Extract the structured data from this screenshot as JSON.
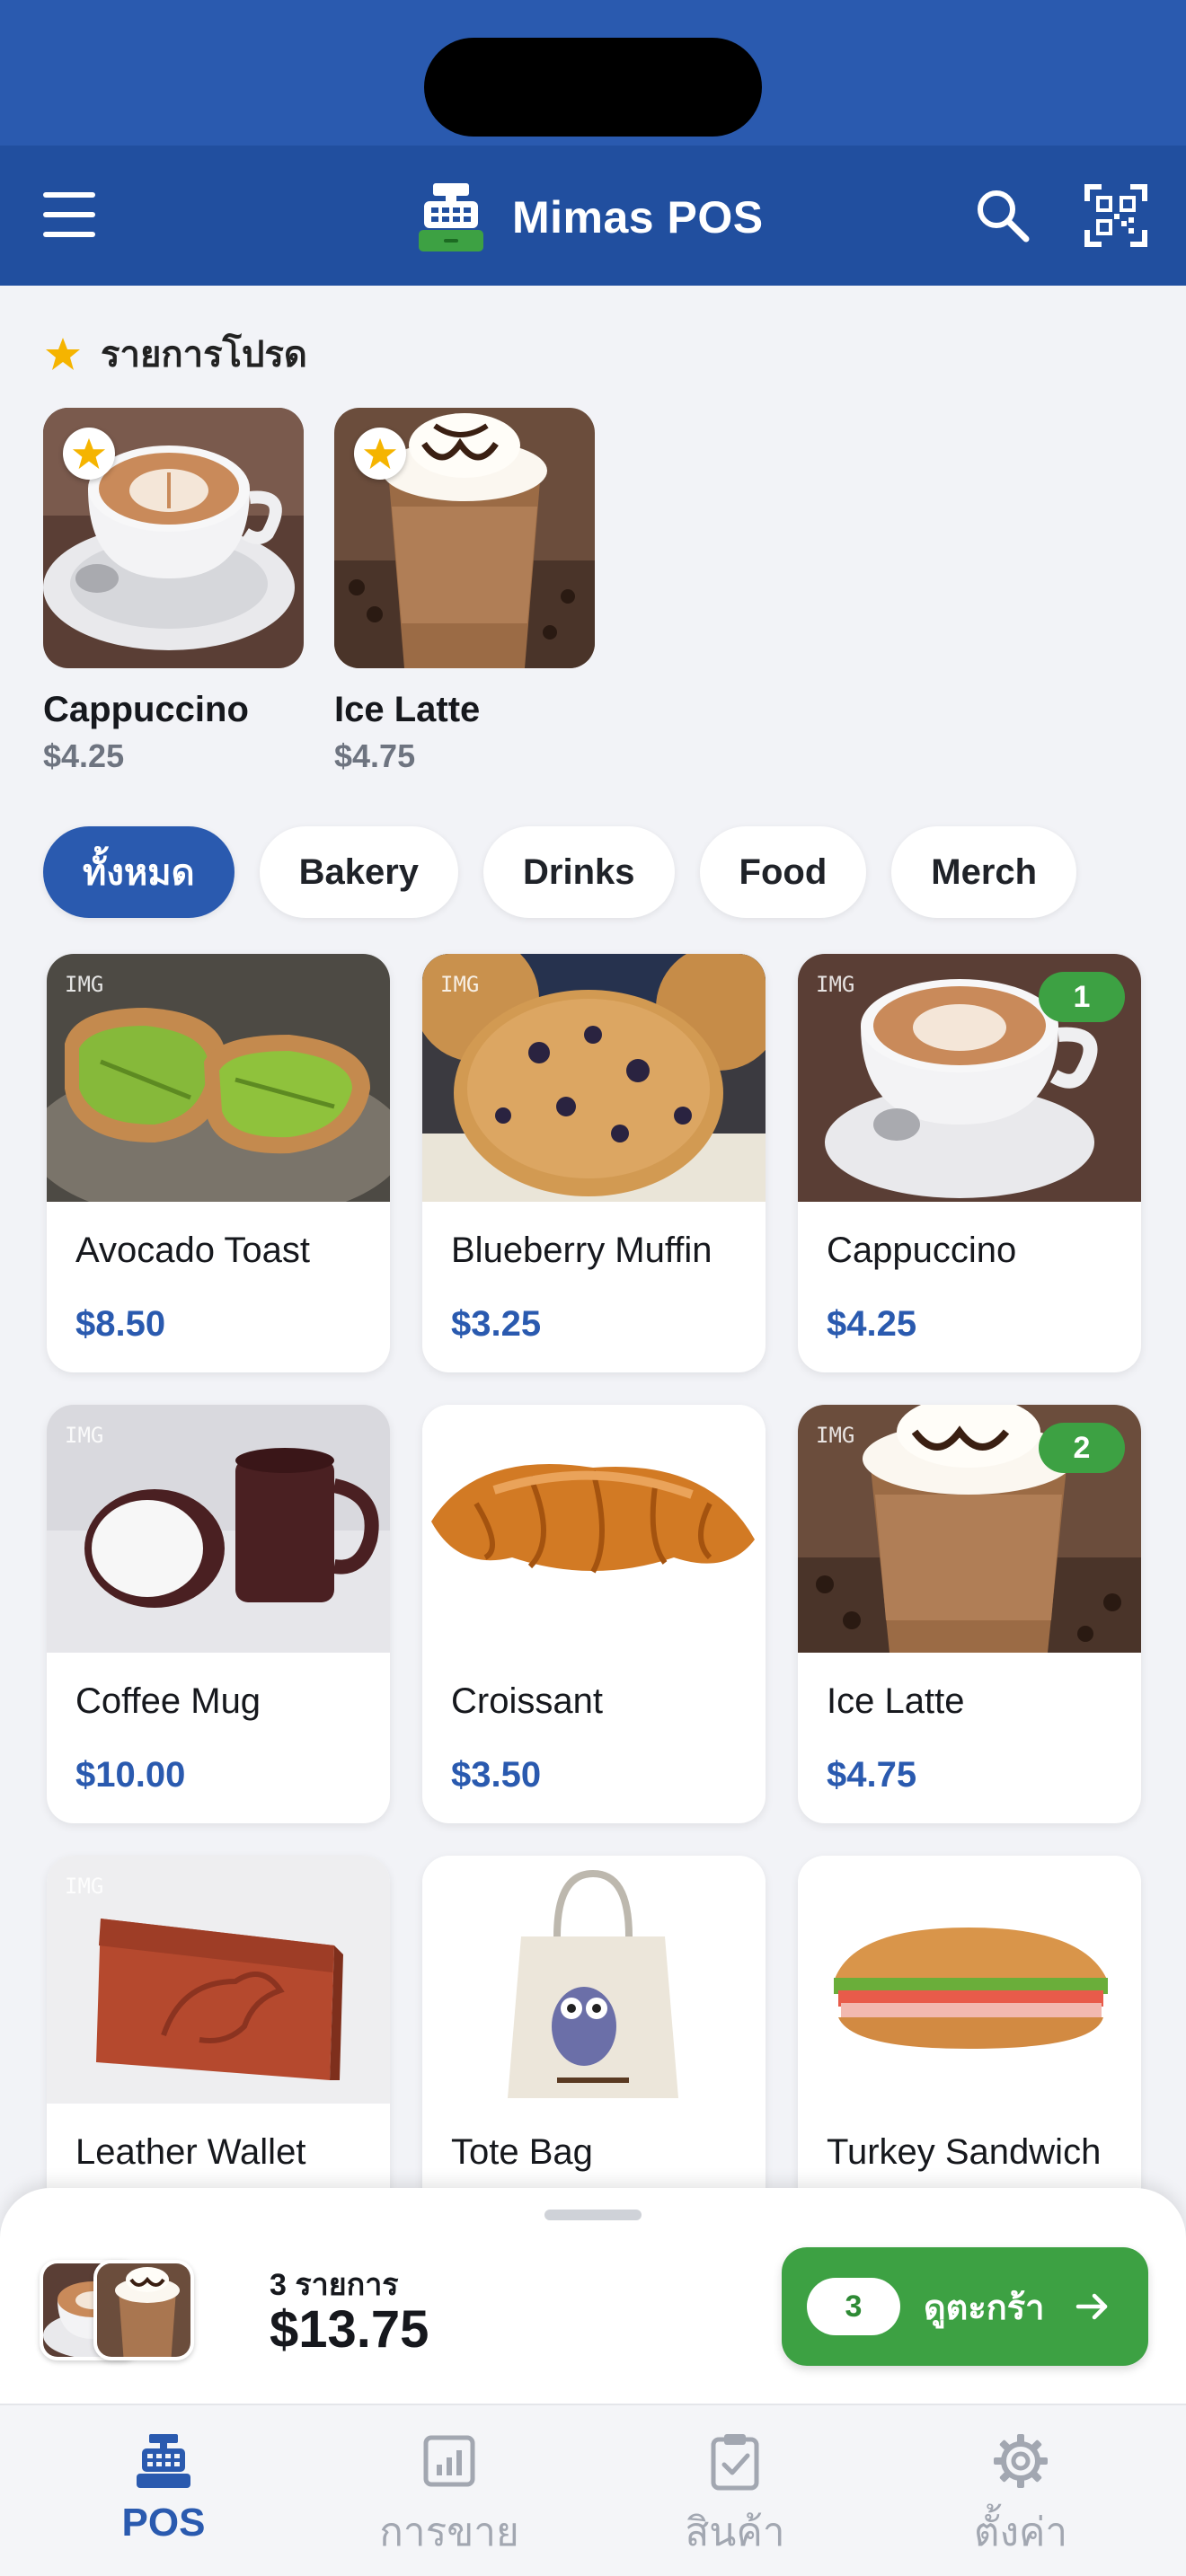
{
  "app": {
    "title": "Mimas POS"
  },
  "favorites": {
    "title": "รายการโปรด",
    "items": [
      {
        "name": "Cappuccino",
        "price": "$4.25"
      },
      {
        "name": "Ice Latte",
        "price": "$4.75"
      }
    ]
  },
  "categories": {
    "items": [
      "ทั้งหมด",
      "Bakery",
      "Drinks",
      "Food",
      "Merch"
    ],
    "selected": "ทั้งหมด"
  },
  "products": [
    {
      "name": "Avocado Toast",
      "price": "$8.50",
      "img_tag": "IMG",
      "qty": ""
    },
    {
      "name": "Blueberry Muffin",
      "price": "$3.25",
      "img_tag": "IMG",
      "qty": ""
    },
    {
      "name": "Cappuccino",
      "price": "$4.25",
      "img_tag": "IMG",
      "qty": "1"
    },
    {
      "name": "Coffee Mug",
      "price": "$10.00",
      "img_tag": "IMG",
      "qty": ""
    },
    {
      "name": "Croissant",
      "price": "$3.50",
      "img_tag": "",
      "qty": ""
    },
    {
      "name": "Ice Latte",
      "price": "$4.75",
      "img_tag": "IMG",
      "qty": "2"
    },
    {
      "name": "Leather Wallet",
      "price": "",
      "img_tag": "IMG",
      "qty": ""
    },
    {
      "name": "Tote Bag",
      "price": "",
      "img_tag": "",
      "qty": ""
    },
    {
      "name": "Turkey Sandwich",
      "price": "",
      "img_tag": "IMG",
      "qty": ""
    }
  ],
  "cart": {
    "count_label": "3 รายการ",
    "total": "$13.75",
    "badge": "3",
    "button_label": "ดูตะกร้า"
  },
  "nav": {
    "items": [
      {
        "label": "POS",
        "icon": "register-icon",
        "active": true
      },
      {
        "label": "การขาย",
        "icon": "chart-icon",
        "active": false
      },
      {
        "label": "สินค้า",
        "icon": "clipboard-icon",
        "active": false
      },
      {
        "label": "ตั้งค่า",
        "icon": "gear-icon",
        "active": false
      }
    ]
  },
  "colors": {
    "primary": "#2a5aaf",
    "app_bar": "#214f9f",
    "success": "#3da143",
    "favorite_star": "#f5b400"
  }
}
